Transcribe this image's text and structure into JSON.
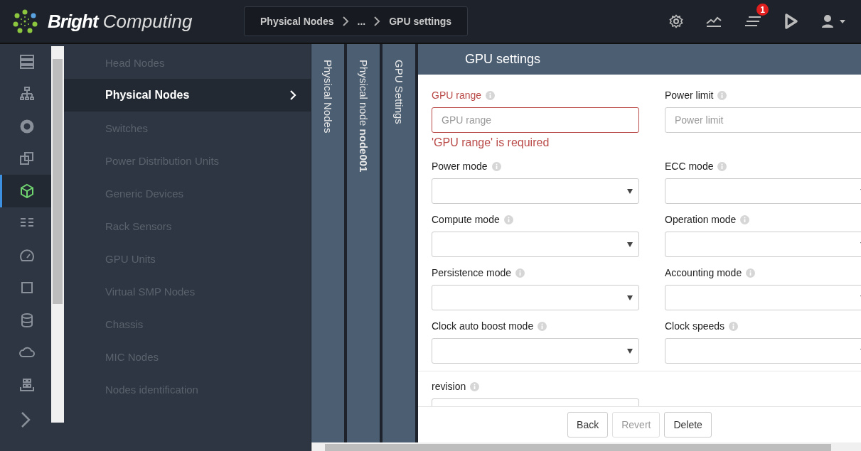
{
  "brand": {
    "bold": "Bright",
    "light": "Computing"
  },
  "breadcrumb": [
    "Physical Nodes",
    "...",
    "GPU settings"
  ],
  "header_icons": [
    {
      "kind": "gear"
    },
    {
      "kind": "chart"
    },
    {
      "kind": "list",
      "badge": "1"
    },
    {
      "kind": "play"
    },
    {
      "kind": "user"
    }
  ],
  "rail": [
    {
      "kind": "servers",
      "selected": false
    },
    {
      "kind": "hierarchy",
      "selected": false
    },
    {
      "kind": "disc",
      "selected": false
    },
    {
      "kind": "copy",
      "selected": false
    },
    {
      "kind": "cube",
      "selected": true
    },
    {
      "kind": "list",
      "selected": false
    },
    {
      "kind": "gauge",
      "selected": false
    },
    {
      "kind": "chip",
      "selected": false
    },
    {
      "kind": "database",
      "selected": false
    },
    {
      "kind": "cloud",
      "selected": false
    },
    {
      "kind": "grid",
      "selected": false
    }
  ],
  "nav": [
    {
      "label": "Head Nodes",
      "selected": false
    },
    {
      "label": "Physical Nodes",
      "selected": true
    },
    {
      "label": "Switches",
      "selected": false
    },
    {
      "label": "Power Distribution Units",
      "selected": false
    },
    {
      "label": "Generic Devices",
      "selected": false
    },
    {
      "label": "Rack Sensors",
      "selected": false
    },
    {
      "label": "GPU Units",
      "selected": false
    },
    {
      "label": "Virtual SMP Nodes",
      "selected": false
    },
    {
      "label": "Chassis",
      "selected": false
    },
    {
      "label": "MIC Nodes",
      "selected": false
    },
    {
      "label": "Nodes identification",
      "selected": false
    }
  ],
  "panels": [
    "Physical Nodes",
    "Physical node **node001**",
    "GPU Settings"
  ],
  "form": {
    "title": "GPU settings",
    "fields": [
      {
        "label": "GPU range",
        "kind": "text",
        "placeholder": "GPU range",
        "error": true,
        "error_text": "'GPU range' is required"
      },
      {
        "label": "Power limit",
        "kind": "text",
        "placeholder": "Power limit",
        "error": false
      },
      {
        "label": "Power mode",
        "kind": "select",
        "error": false
      },
      {
        "label": "ECC mode",
        "kind": "select",
        "error": false
      },
      {
        "label": "Compute mode",
        "kind": "select",
        "error": false
      },
      {
        "label": "Operation mode",
        "kind": "select",
        "error": false
      },
      {
        "label": "Persistence mode",
        "kind": "select",
        "error": false
      },
      {
        "label": "Accounting mode",
        "kind": "select",
        "error": false
      },
      {
        "label": "Clock auto boost mode",
        "kind": "select",
        "error": false
      },
      {
        "label": "Clock speeds",
        "kind": "select",
        "error": false
      }
    ],
    "extra_fields": [
      {
        "label": "revision",
        "error": false
      }
    ],
    "buttons": [
      {
        "label": "Back",
        "disabled": false
      },
      {
        "label": "Revert",
        "disabled": true
      },
      {
        "label": "Delete",
        "disabled": false
      }
    ]
  }
}
